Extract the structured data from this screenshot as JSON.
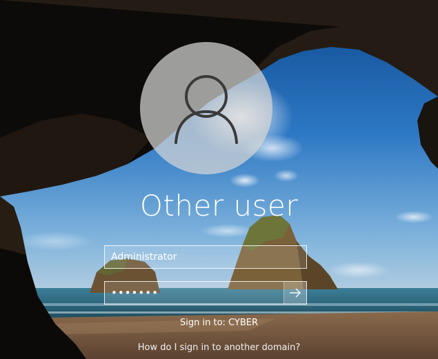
{
  "user": {
    "display_name": "Other user"
  },
  "form": {
    "username_value": "Administrator",
    "password_value": "•••••••"
  },
  "sign_in": {
    "domain_text": "Sign in to: CYBER",
    "help_link": "How do I sign in to another domain?"
  },
  "icons": {
    "avatar": "user-silhouette-icon",
    "submit": "arrow-right-icon"
  },
  "colors": {
    "text": "#ffffff",
    "field_border": "#ffffff",
    "avatar_bg": "#d6d6d6"
  }
}
